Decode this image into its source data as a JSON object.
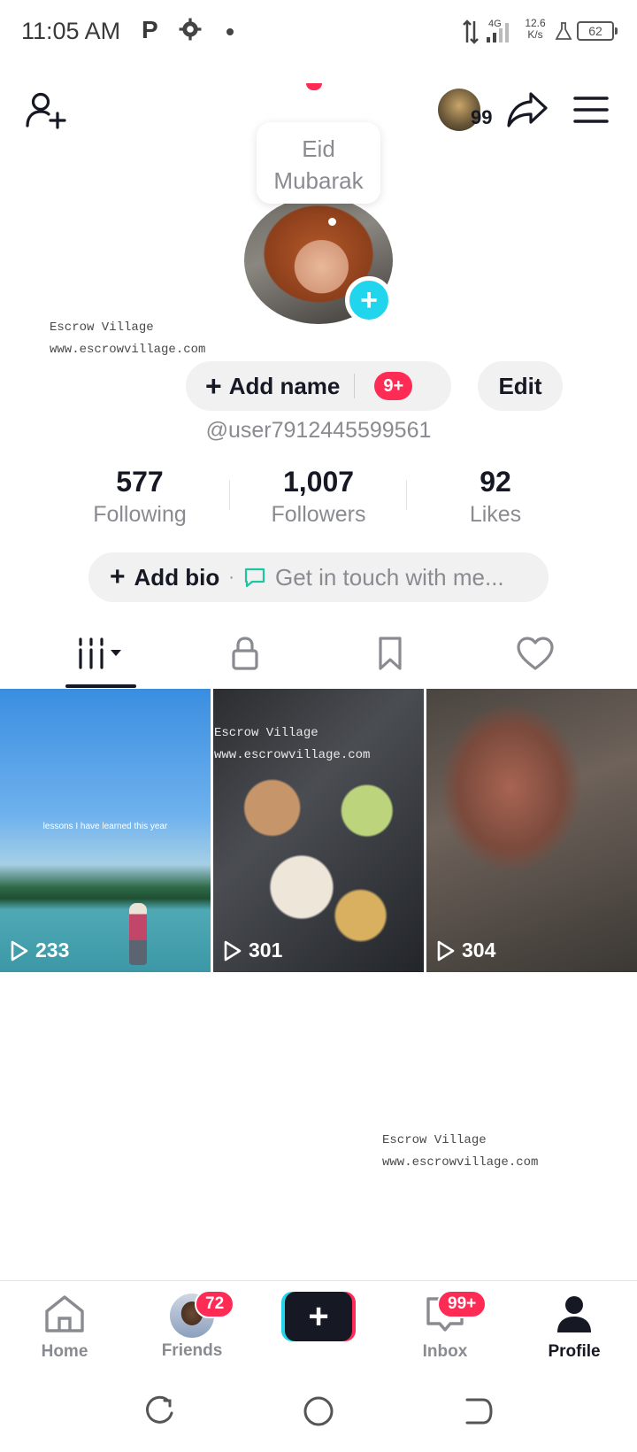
{
  "status_bar": {
    "time": "11:05 AM",
    "p_icon": "P",
    "network": "4G",
    "speed_value": "12.6",
    "speed_unit": "K/s",
    "battery": "62",
    "icons": [
      "p-icon",
      "gear-icon",
      "dot-icon",
      "data-arrows-icon",
      "signal-icon",
      "flask-icon",
      "battery-icon"
    ]
  },
  "header": {
    "icons": [
      "add-friend-icon",
      "share-icon",
      "menu-icon"
    ],
    "story_count": "99"
  },
  "profile": {
    "bubble_text": "Eid Mubarak",
    "add_avatar_symbol": "+",
    "add_name_label": "Add name",
    "add_name_badge": "9+",
    "edit_label": "Edit",
    "username": "@user7912445599561",
    "stats": [
      {
        "value": "577",
        "label": "Following"
      },
      {
        "value": "1,007",
        "label": "Followers"
      },
      {
        "value": "92",
        "label": "Likes"
      }
    ],
    "add_bio_label": "Add bio",
    "bio_separator": "·",
    "get_in_touch": "Get in touch with me..."
  },
  "watermark": {
    "line1": "Escrow Village",
    "line2": "www.escrowvillage.com"
  },
  "tabs": [
    {
      "name": "videos",
      "icon": "videos-grid-icon",
      "active": true
    },
    {
      "name": "private",
      "icon": "lock-icon",
      "active": false
    },
    {
      "name": "saved",
      "icon": "bookmark-icon",
      "active": false
    },
    {
      "name": "liked",
      "icon": "heart-icon",
      "active": false
    }
  ],
  "videos": [
    {
      "views": "233",
      "overlay_text": "lessons I have learned this year"
    },
    {
      "views": "301",
      "overlay_text": ""
    },
    {
      "views": "304",
      "overlay_text": ""
    }
  ],
  "bottom_nav": {
    "home": "Home",
    "friends": "Friends",
    "friends_badge": "72",
    "create_symbol": "+",
    "inbox": "Inbox",
    "inbox_badge": "99+",
    "profile": "Profile"
  },
  "colors": {
    "accent_red": "#fe2c55",
    "accent_cyan": "#20d5ec",
    "text_primary": "#161823",
    "text_secondary": "#8a8b91"
  }
}
